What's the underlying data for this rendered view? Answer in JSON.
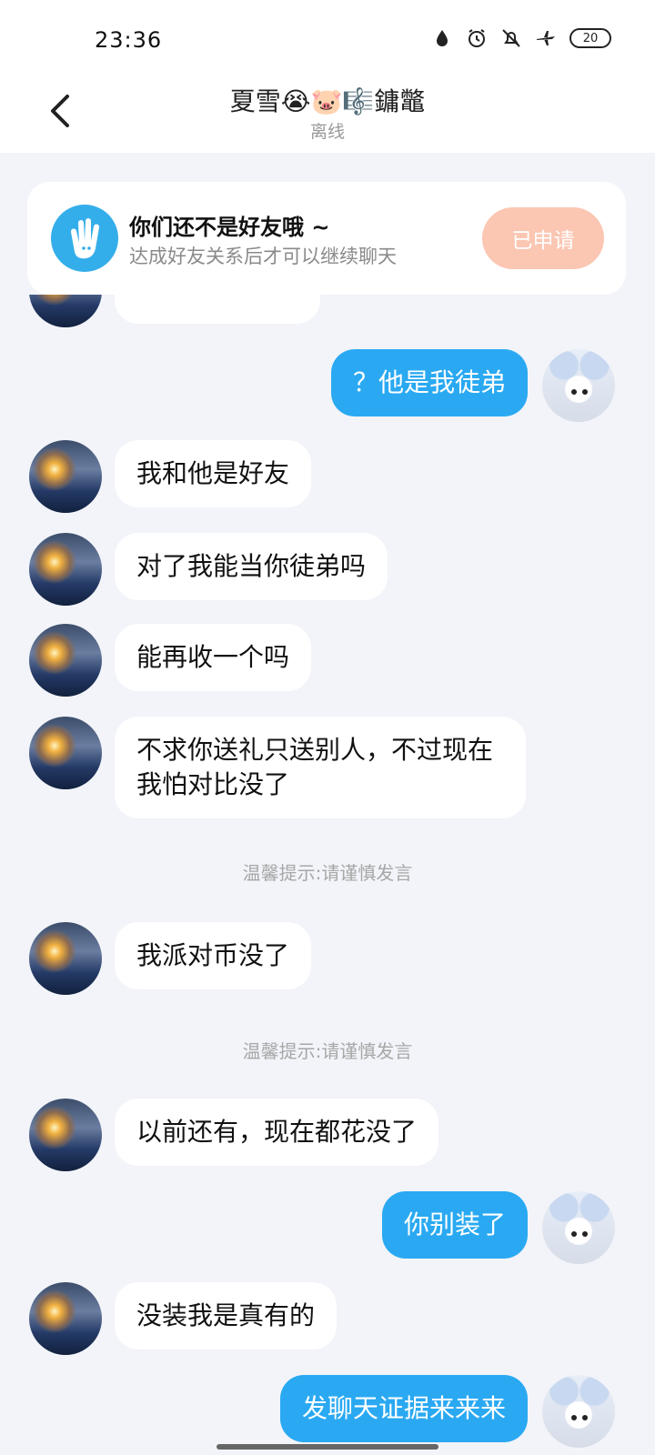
{
  "status_bar": {
    "time": "23:36",
    "icons": [
      "water-drop-icon",
      "alarm-clock-icon",
      "bell-muted-icon",
      "airplane-mode-icon"
    ],
    "battery": "20"
  },
  "header": {
    "title": "夏雪😭🐷🎼鏞鼈",
    "subtitle": "离线"
  },
  "notice_card": {
    "title": "你们还不是好友哦 ~",
    "subtitle": "达成好友关系后才可以继续聊天",
    "button": "已申请",
    "accent": "#34aeea",
    "button_color": "#fbc6b2"
  },
  "messages": [
    {
      "side": "out",
      "text": "？他是我徒弟"
    },
    {
      "side": "in",
      "text": "我和他是好友"
    },
    {
      "side": "in",
      "text": "对了我能当你徒弟吗"
    },
    {
      "side": "in",
      "text": "能再收一个吗"
    },
    {
      "side": "in",
      "text": "不求你送礼只送别人，不过现在我怕对比没了"
    },
    {
      "side": "tip",
      "text": "温馨提示:请谨慎发言"
    },
    {
      "side": "in",
      "text": "我派对币没了"
    },
    {
      "side": "tip",
      "text": "温馨提示:请谨慎发言"
    },
    {
      "side": "in",
      "text": "以前还有，现在都花没了"
    },
    {
      "side": "out",
      "text": "你别装了"
    },
    {
      "side": "in",
      "text": "没装我是真有的"
    },
    {
      "side": "out",
      "text": "发聊天证据来来来"
    }
  ],
  "colors": {
    "outgoing_bubble": "#2aa9f2",
    "incoming_bubble": "#ffffff",
    "background": "#f2f4f9"
  }
}
